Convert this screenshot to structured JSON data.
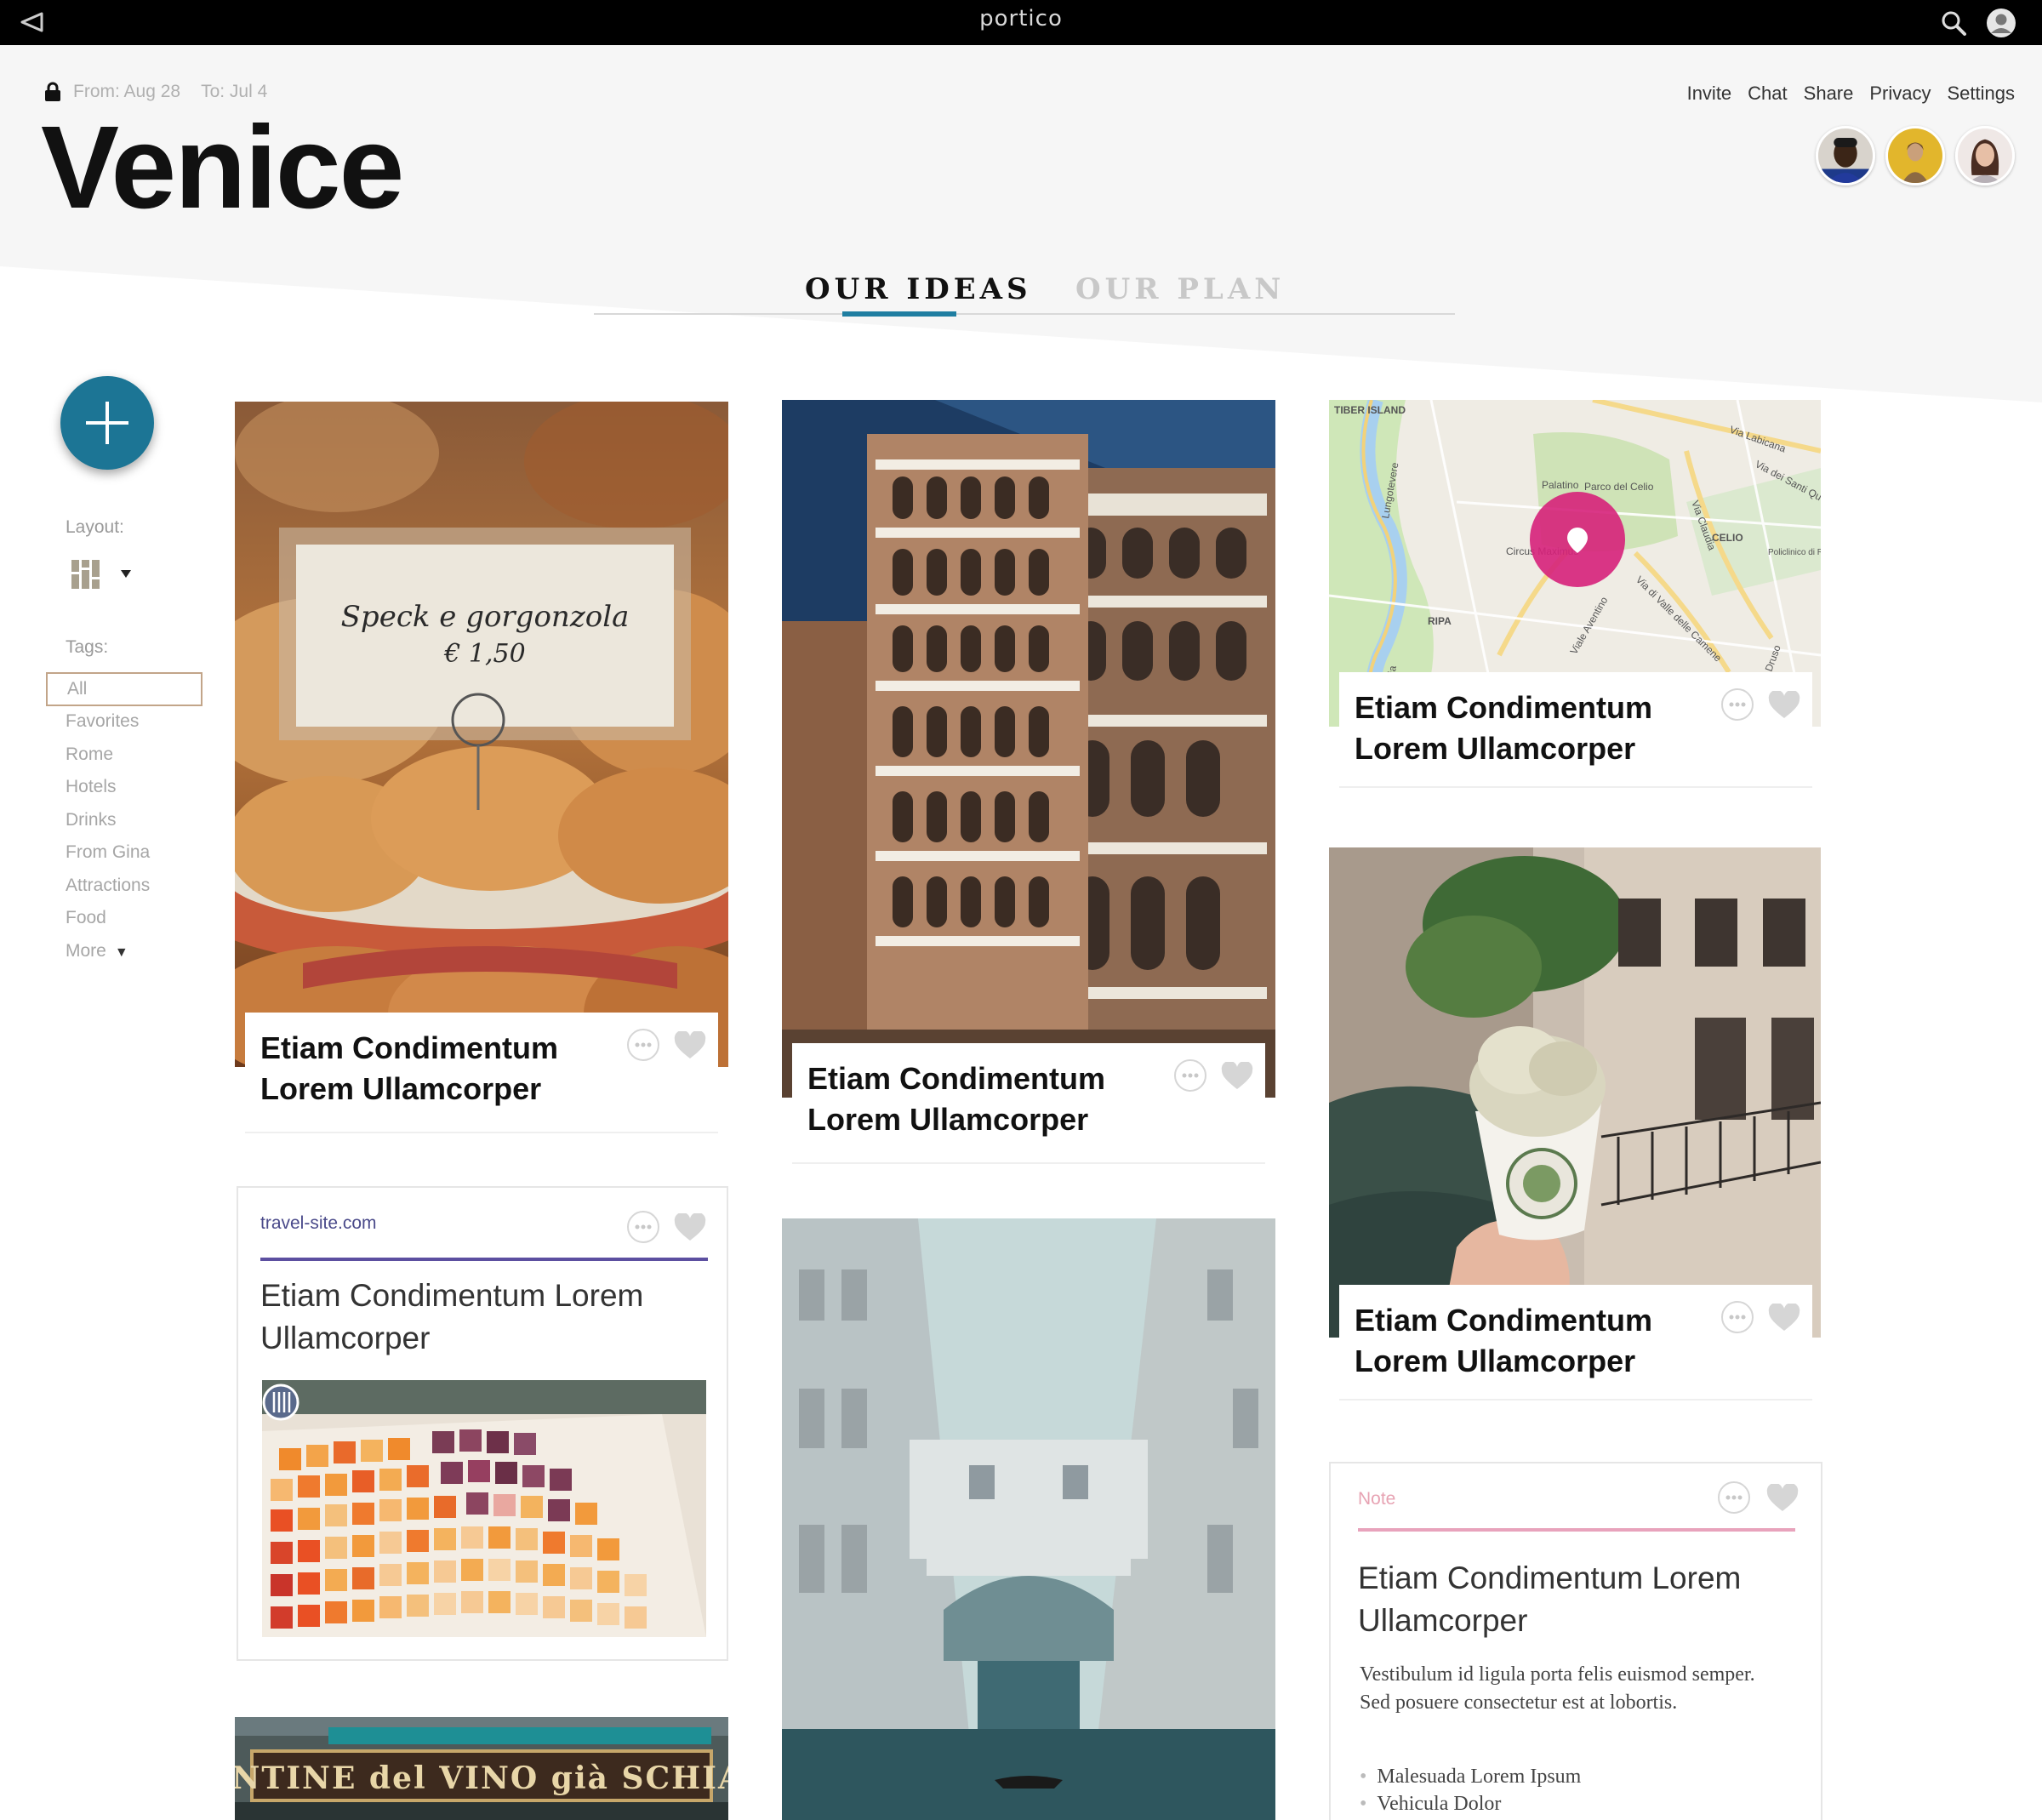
{
  "app": {
    "brand": "portico",
    "back_icon": "back-arrow-icon",
    "search_icon": "search-icon",
    "user_icon": "user-account-icon"
  },
  "trip": {
    "lock_icon": "lock-icon",
    "from": "From: Aug 28",
    "to": "To: Jul 4",
    "city": "Venice"
  },
  "header_links": [
    "Invite",
    "Chat",
    "Share",
    "Privacy",
    "Settings"
  ],
  "tabs": {
    "ideas": "OUR IDEAS",
    "plan": "OUR PLAN",
    "active": "ideas"
  },
  "sidebar": {
    "layout_label": "Layout:",
    "tags_label": "Tags:",
    "tags": [
      "All",
      "Favorites",
      "Rome",
      "Hotels",
      "Drinks",
      "From Gina",
      "Attractions",
      "Food",
      "More"
    ],
    "active_tag": "All"
  },
  "cards": {
    "sandwich_title": "Etiam Condimentum Lorem Ullamcorper",
    "sandwich_sign_line1": "Speck e gorgonzola",
    "sandwich_sign_line2": "€ 1,50",
    "tower_title": "Etiam Condimentum Lorem Ullamcorper",
    "map_title": "Etiam Condimentum Lorem Ullamcorper",
    "map_labels": [
      "TIBER ISLAND",
      "Palatino",
      "Parco del Celio",
      "CELIO",
      "Circus Maximus",
      "RIPA",
      "Via Labicana",
      "Via dei Santi Qu",
      "Policlinico di Roma",
      "Viale Aventino",
      "Via di Valle delle Camene",
      "Lungotevere",
      "Via Claudia",
      "Druso",
      "Via"
    ],
    "gelato_title": "Etiam Condimentum Lorem Ullamcorper",
    "link_site": "travel-site.com",
    "link_title": "Etiam Condimentum Lorem Ullamcorper",
    "note_label": "Note",
    "note_title": "Etiam Condimentum Lorem Ullamcorper",
    "note_body": "Vestibulum id ligula porta felis euismod semper. Sed posuere consectetur est at lobortis.",
    "note_items": [
      "Malesuada Lorem Ipsum",
      "Vehicula Dolor"
    ],
    "shop_sign": "CANTINE del VINO già SCHIAVI"
  },
  "colors": {
    "accent": "#1c7595",
    "tab_underline": "#1f7ea1",
    "link_rule": "#5c4fa0",
    "note_rule": "#e8a3bc",
    "map_pin": "#d6217a"
  }
}
